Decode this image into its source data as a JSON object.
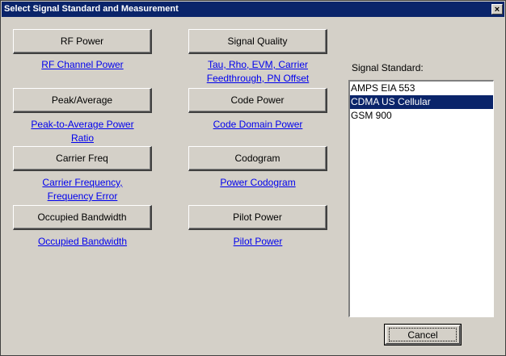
{
  "dialog": {
    "title": "Select Signal Standard and Measurement",
    "close_label": "×"
  },
  "measurements": [
    {
      "button": "RF Power",
      "link": "RF Channel Power"
    },
    {
      "button": "Signal Quality",
      "link_line1": "Tau, Rho, EVM, Carrier",
      "link_line2": "Feedthrough, PN Offset"
    },
    {
      "button": "Peak/Average",
      "link_line1": "Peak-to-Average Power",
      "link_line2": "Ratio"
    },
    {
      "button": "Code Power",
      "link": "Code Domain Power"
    },
    {
      "button": "Carrier Freq",
      "link_line1": "Carrier Frequency,",
      "link_line2": "Frequency Error"
    },
    {
      "button": "Codogram",
      "link": "Power Codogram"
    },
    {
      "button": "Occupied Bandwidth",
      "link": "Occupied Bandwidth"
    },
    {
      "button": "Pilot Power",
      "link": "Pilot Power"
    }
  ],
  "signal_standard": {
    "label": "Signal Standard:",
    "options": [
      "AMPS EIA 553",
      "CDMA US Cellular",
      "GSM 900"
    ],
    "selected": "CDMA US Cellular"
  },
  "cancel_label": "Cancel",
  "colors": {
    "title_bar": "#0a246a",
    "dialog_bg": "#d4d0c8",
    "link": "#0000ee",
    "selection": "#0a246a"
  }
}
